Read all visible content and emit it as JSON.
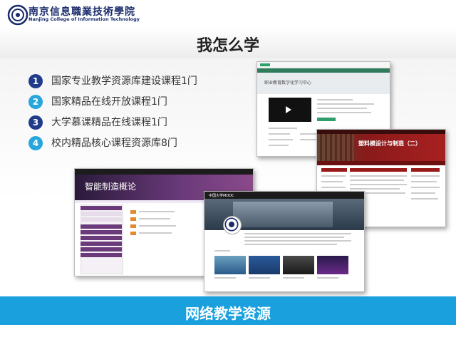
{
  "school": {
    "name_cn": "南京信息職業技術學院",
    "name_en": "Nanjing College of Information Technology"
  },
  "title": "我怎么学",
  "items": [
    {
      "num": "1",
      "label": "国家专业教学资源库建设课程1门",
      "color": "#1f3b8a"
    },
    {
      "num": "2",
      "label": "国家精品在线开放课程1门",
      "color": "#27a6dd"
    },
    {
      "num": "3",
      "label": "大学慕课精品在线课程1门",
      "color": "#1f3b8a"
    },
    {
      "num": "4",
      "label": "校内精品核心课程资源库8门",
      "color": "#27a6dd"
    }
  ],
  "screenshots": {
    "vocational": {
      "banner": "职业教育数字化学习中心"
    },
    "plastic": {
      "banner": "塑料模设计与制造（二）"
    },
    "smart": {
      "banner": "智能制造概论"
    },
    "mooc": {
      "banner": "中国大学MOOC"
    }
  },
  "footer": "网络教学资源",
  "colors": {
    "footer_bar": "#1aa0dc",
    "accent_red": "#8b1a1a",
    "accent_purple": "#5a2a6a",
    "dark_navy": "#1a2b6b"
  }
}
